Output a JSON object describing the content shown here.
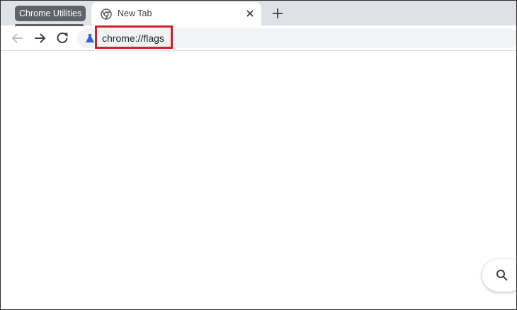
{
  "tab_group": {
    "label": "Chrome Utilities"
  },
  "tabs": [
    {
      "title": "New Tab",
      "favicon": "chrome-icon"
    }
  ],
  "toolbar": {
    "back_icon": "back-arrow-icon",
    "forward_icon": "forward-arrow-icon",
    "reload_icon": "reload-icon"
  },
  "omnibox": {
    "site_icon": "lab-flask-icon",
    "url": "chrome://flags"
  },
  "colors": {
    "highlight": "#d32029",
    "tab_group": "#5f6368",
    "tabstrip": "#dee1e6",
    "omnibox_bg": "#f1f3f4"
  },
  "fab": {
    "icon": "search-icon"
  }
}
